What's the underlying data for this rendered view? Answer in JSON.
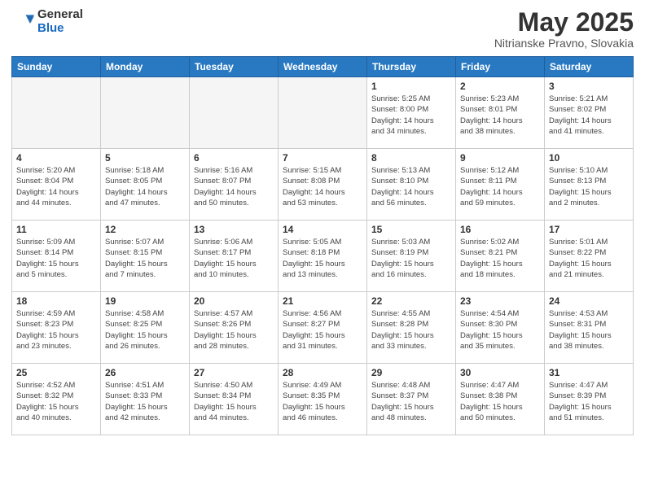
{
  "header": {
    "logo_general": "General",
    "logo_blue": "Blue",
    "title": "May 2025",
    "location": "Nitrianske Pravno, Slovakia"
  },
  "weekdays": [
    "Sunday",
    "Monday",
    "Tuesday",
    "Wednesday",
    "Thursday",
    "Friday",
    "Saturday"
  ],
  "weeks": [
    [
      {
        "day": "",
        "info": ""
      },
      {
        "day": "",
        "info": ""
      },
      {
        "day": "",
        "info": ""
      },
      {
        "day": "",
        "info": ""
      },
      {
        "day": "1",
        "info": "Sunrise: 5:25 AM\nSunset: 8:00 PM\nDaylight: 14 hours\nand 34 minutes."
      },
      {
        "day": "2",
        "info": "Sunrise: 5:23 AM\nSunset: 8:01 PM\nDaylight: 14 hours\nand 38 minutes."
      },
      {
        "day": "3",
        "info": "Sunrise: 5:21 AM\nSunset: 8:02 PM\nDaylight: 14 hours\nand 41 minutes."
      }
    ],
    [
      {
        "day": "4",
        "info": "Sunrise: 5:20 AM\nSunset: 8:04 PM\nDaylight: 14 hours\nand 44 minutes."
      },
      {
        "day": "5",
        "info": "Sunrise: 5:18 AM\nSunset: 8:05 PM\nDaylight: 14 hours\nand 47 minutes."
      },
      {
        "day": "6",
        "info": "Sunrise: 5:16 AM\nSunset: 8:07 PM\nDaylight: 14 hours\nand 50 minutes."
      },
      {
        "day": "7",
        "info": "Sunrise: 5:15 AM\nSunset: 8:08 PM\nDaylight: 14 hours\nand 53 minutes."
      },
      {
        "day": "8",
        "info": "Sunrise: 5:13 AM\nSunset: 8:10 PM\nDaylight: 14 hours\nand 56 minutes."
      },
      {
        "day": "9",
        "info": "Sunrise: 5:12 AM\nSunset: 8:11 PM\nDaylight: 14 hours\nand 59 minutes."
      },
      {
        "day": "10",
        "info": "Sunrise: 5:10 AM\nSunset: 8:13 PM\nDaylight: 15 hours\nand 2 minutes."
      }
    ],
    [
      {
        "day": "11",
        "info": "Sunrise: 5:09 AM\nSunset: 8:14 PM\nDaylight: 15 hours\nand 5 minutes."
      },
      {
        "day": "12",
        "info": "Sunrise: 5:07 AM\nSunset: 8:15 PM\nDaylight: 15 hours\nand 7 minutes."
      },
      {
        "day": "13",
        "info": "Sunrise: 5:06 AM\nSunset: 8:17 PM\nDaylight: 15 hours\nand 10 minutes."
      },
      {
        "day": "14",
        "info": "Sunrise: 5:05 AM\nSunset: 8:18 PM\nDaylight: 15 hours\nand 13 minutes."
      },
      {
        "day": "15",
        "info": "Sunrise: 5:03 AM\nSunset: 8:19 PM\nDaylight: 15 hours\nand 16 minutes."
      },
      {
        "day": "16",
        "info": "Sunrise: 5:02 AM\nSunset: 8:21 PM\nDaylight: 15 hours\nand 18 minutes."
      },
      {
        "day": "17",
        "info": "Sunrise: 5:01 AM\nSunset: 8:22 PM\nDaylight: 15 hours\nand 21 minutes."
      }
    ],
    [
      {
        "day": "18",
        "info": "Sunrise: 4:59 AM\nSunset: 8:23 PM\nDaylight: 15 hours\nand 23 minutes."
      },
      {
        "day": "19",
        "info": "Sunrise: 4:58 AM\nSunset: 8:25 PM\nDaylight: 15 hours\nand 26 minutes."
      },
      {
        "day": "20",
        "info": "Sunrise: 4:57 AM\nSunset: 8:26 PM\nDaylight: 15 hours\nand 28 minutes."
      },
      {
        "day": "21",
        "info": "Sunrise: 4:56 AM\nSunset: 8:27 PM\nDaylight: 15 hours\nand 31 minutes."
      },
      {
        "day": "22",
        "info": "Sunrise: 4:55 AM\nSunset: 8:28 PM\nDaylight: 15 hours\nand 33 minutes."
      },
      {
        "day": "23",
        "info": "Sunrise: 4:54 AM\nSunset: 8:30 PM\nDaylight: 15 hours\nand 35 minutes."
      },
      {
        "day": "24",
        "info": "Sunrise: 4:53 AM\nSunset: 8:31 PM\nDaylight: 15 hours\nand 38 minutes."
      }
    ],
    [
      {
        "day": "25",
        "info": "Sunrise: 4:52 AM\nSunset: 8:32 PM\nDaylight: 15 hours\nand 40 minutes."
      },
      {
        "day": "26",
        "info": "Sunrise: 4:51 AM\nSunset: 8:33 PM\nDaylight: 15 hours\nand 42 minutes."
      },
      {
        "day": "27",
        "info": "Sunrise: 4:50 AM\nSunset: 8:34 PM\nDaylight: 15 hours\nand 44 minutes."
      },
      {
        "day": "28",
        "info": "Sunrise: 4:49 AM\nSunset: 8:35 PM\nDaylight: 15 hours\nand 46 minutes."
      },
      {
        "day": "29",
        "info": "Sunrise: 4:48 AM\nSunset: 8:37 PM\nDaylight: 15 hours\nand 48 minutes."
      },
      {
        "day": "30",
        "info": "Sunrise: 4:47 AM\nSunset: 8:38 PM\nDaylight: 15 hours\nand 50 minutes."
      },
      {
        "day": "31",
        "info": "Sunrise: 4:47 AM\nSunset: 8:39 PM\nDaylight: 15 hours\nand 51 minutes."
      }
    ]
  ]
}
